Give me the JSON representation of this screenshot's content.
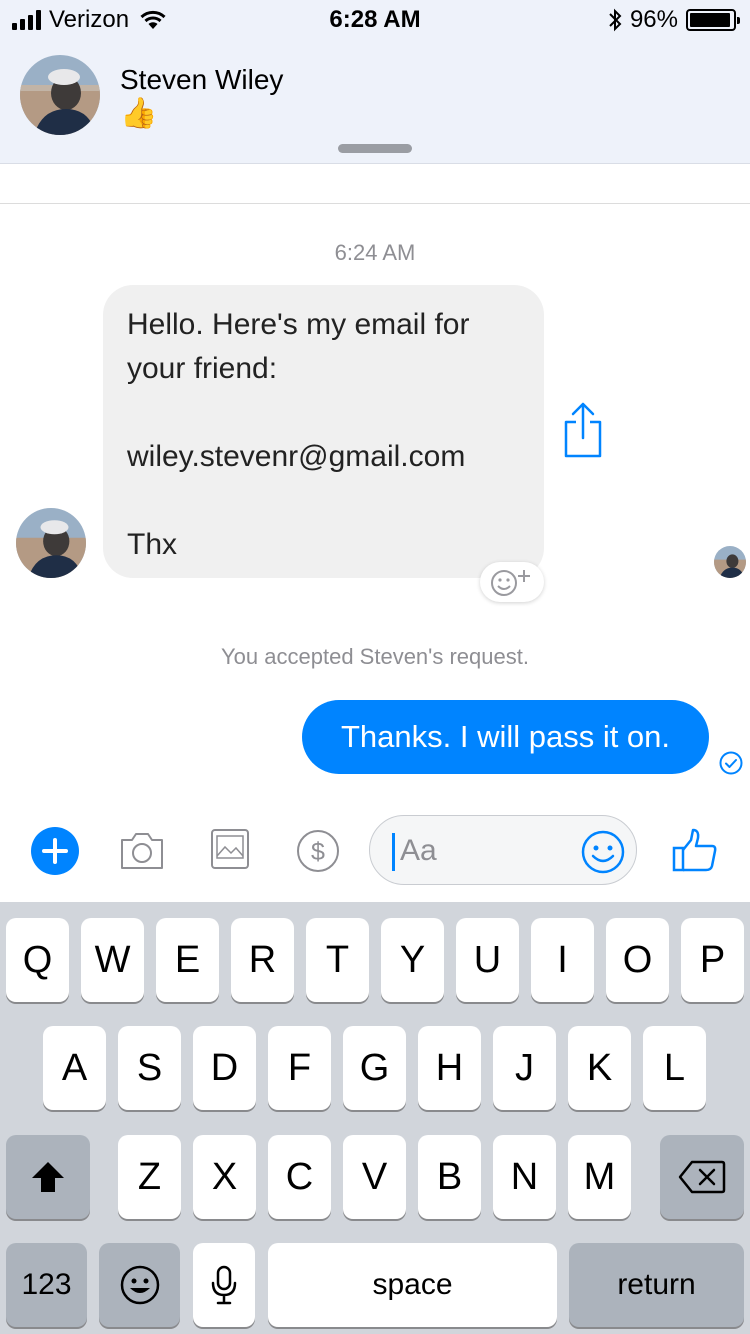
{
  "status_bar": {
    "carrier": "Verizon",
    "time": "6:28 AM",
    "battery_text": "96%",
    "battery_level": 0.96,
    "icons": [
      "signal-bars-icon",
      "wifi-icon",
      "bluetooth-icon",
      "battery-icon"
    ]
  },
  "header": {
    "contact_name": "Steven Wiley",
    "contact_status": "👍"
  },
  "conversation": {
    "timestamp": "6:24 AM",
    "incoming_message": "Hello. Here's my email for your friend:\n\n wiley.stevenr@gmail.com\n\nThx",
    "system_note": "You accepted Steven's request.",
    "outgoing_message": "Thanks. I will pass it on."
  },
  "composer": {
    "placeholder": "Aa",
    "icons": [
      "plus-icon",
      "camera-icon",
      "image-icon",
      "dollar-icon",
      "smiley-icon",
      "thumbs-up-icon"
    ]
  },
  "keyboard": {
    "row1": [
      "Q",
      "W",
      "E",
      "R",
      "T",
      "Y",
      "U",
      "I",
      "O",
      "P"
    ],
    "row2": [
      "A",
      "S",
      "D",
      "F",
      "G",
      "H",
      "J",
      "K",
      "L"
    ],
    "row3": [
      "Z",
      "X",
      "C",
      "V",
      "B",
      "N",
      "M"
    ],
    "numbers_key": "123",
    "space_key": "space",
    "return_key": "return"
  },
  "colors": {
    "accent": "#0084ff",
    "header_bg": "#eef2fa",
    "keyboard_bg": "#d1d5db"
  }
}
